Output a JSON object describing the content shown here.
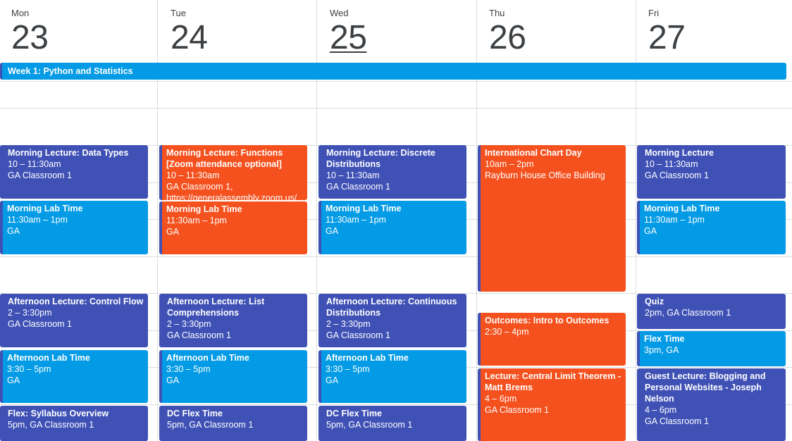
{
  "days": [
    {
      "name": "Mon",
      "num": "23"
    },
    {
      "name": "Tue",
      "num": "24"
    },
    {
      "name": "Wed",
      "num": "25"
    },
    {
      "name": "Thu",
      "num": "26"
    },
    {
      "name": "Fri",
      "num": "27"
    }
  ],
  "allday": {
    "title": "Week 1: Python and Statistics"
  },
  "events": {
    "mon_lecture": {
      "title": "Morning Lecture: Data Types",
      "time": "10 – 11:30am",
      "location": "GA Classroom 1"
    },
    "mon_lab": {
      "title": "Morning Lab Time",
      "time": "11:30am – 1pm",
      "location": "GA"
    },
    "mon_aft_lecture": {
      "title": "Afternoon Lecture: Control Flow",
      "time": "2 – 3:30pm",
      "location": "GA Classroom 1"
    },
    "mon_aft_lab": {
      "title": "Afternoon Lab Time",
      "time": "3:30 – 5pm",
      "location": "GA"
    },
    "mon_flex": {
      "title": "Flex: Syllabus Overview",
      "time": "5pm, GA Classroom 1"
    },
    "tue_lecture": {
      "title": "Morning Lecture: Functions [Zoom attendance optional]",
      "time": "10 – 11:30am",
      "location": "GA Classroom 1,",
      "extra": "https://generalassembly.zoom.us/"
    },
    "tue_lab": {
      "title": "Morning Lab Time",
      "time": "11:30am – 1pm",
      "location": "GA"
    },
    "tue_aft_lecture": {
      "title": "Afternoon Lecture: List Comprehensions",
      "time": "2 – 3:30pm",
      "location": "GA Classroom 1"
    },
    "tue_aft_lab": {
      "title": "Afternoon Lab Time",
      "time": "3:30 – 5pm",
      "location": "GA"
    },
    "tue_flex": {
      "title": "DC Flex Time",
      "time": "5pm, GA Classroom 1"
    },
    "wed_lecture": {
      "title": "Morning Lecture: Discrete Distributions",
      "time": "10 – 11:30am",
      "location": "GA Classroom 1"
    },
    "wed_lab": {
      "title": "Morning Lab Time",
      "time": "11:30am – 1pm",
      "location": "GA"
    },
    "wed_aft_lecture": {
      "title": "Afternoon Lecture: Continuous Distributions",
      "time": "2 – 3:30pm",
      "location": "GA Classroom 1"
    },
    "wed_aft_lab": {
      "title": "Afternoon Lab Time",
      "time": "3:30 – 5pm",
      "location": "GA"
    },
    "wed_flex": {
      "title": "DC Flex Time",
      "time": "5pm, GA Classroom 1"
    },
    "thu_chart": {
      "title": "International Chart Day",
      "time": "10am – 2pm",
      "location": "Rayburn House Office Building"
    },
    "thu_outcomes": {
      "title": "Outcomes: Intro to Outcomes",
      "time": "2:30 – 4pm"
    },
    "thu_clt": {
      "title": "Lecture: Central Limit Theorem - Matt Brems",
      "time": "4 – 6pm",
      "location": "GA Classroom 1"
    },
    "fri_lecture": {
      "title": "Morning Lecture",
      "time": "10 – 11:30am",
      "location": "GA Classroom 1"
    },
    "fri_lab": {
      "title": "Morning Lab Time",
      "time": "11:30am – 1pm",
      "location": "GA"
    },
    "fri_quiz": {
      "title": "Quiz",
      "time": "2pm, GA Classroom 1"
    },
    "fri_flex": {
      "title": "Flex Time",
      "time": "3pm, GA"
    },
    "fri_guest": {
      "title": "Guest Lecture: Blogging and Personal Websites - Joseph Nelson",
      "time": "4 – 6pm",
      "location": "GA Classroom 1"
    }
  },
  "colors": {
    "blue": "#039be5",
    "indigo": "#3f51b5",
    "orange": "#f4511e"
  }
}
